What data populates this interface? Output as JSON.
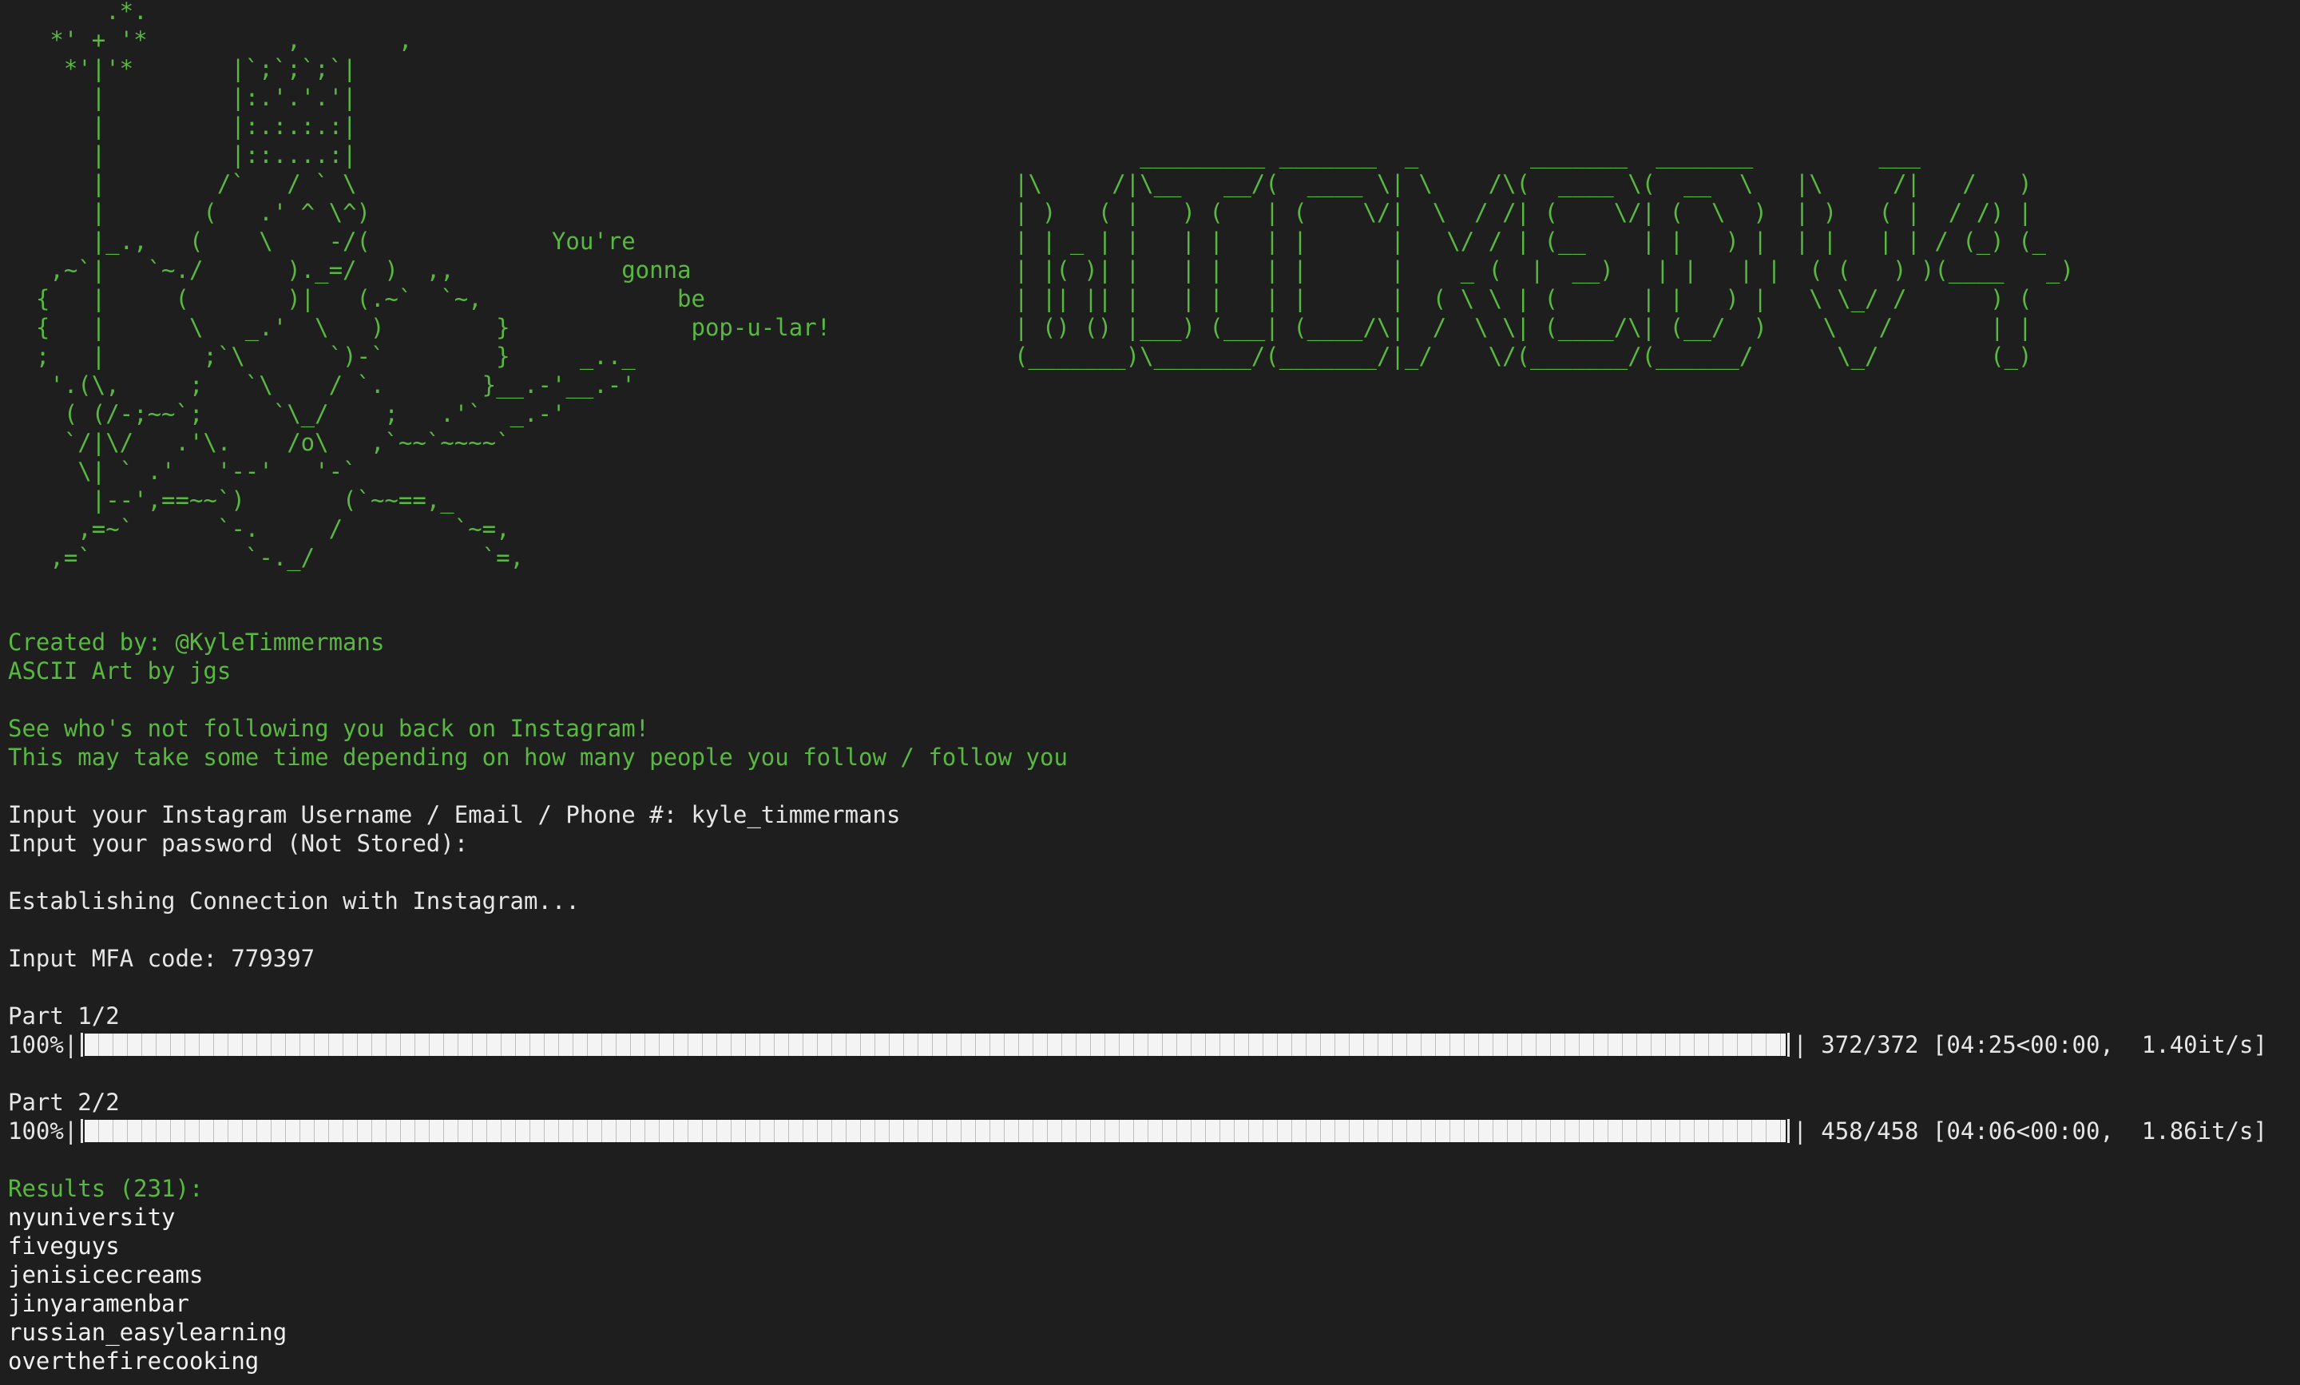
{
  "ascii_art": {
    "left": "       .*.\n   *' + '*          ,       ,\n    *'|'*       |`;`;`;`|\n      |         |:.'.'.'|\n      |         |:.:.:.:|\n      |         |::....:|\n      |        /`   / ` \\\n      |       (   .' ^ \\^)\n      |_.,   (    \\    -/(             You're\n   ,~`|   `~./      )._=/  )  ,,            gonna\n  {   |     (       )|   (.~`  `~,              be\n  {   |      \\   _.'  \\   )        }             pop-u-lar!\n  ;   |       ;`\\      `)-`        }     _.._\n   '.(\\,     ;   `\\    / `.       }__.-'__.-'\n    ( (/-;~~`;     `\\_/    ;   .'`  _.-'\n    `/|\\/   .'\\.    /o\\   ,`~~`~~~~`\n     \\| ` .'   '--'   '-`\n      |--',==~~`)       (`~~==,_\n     ,=~`      `-.     /        `~=,\n   ,=`           `-._/            `=,",
    "right": "         _________ _______  _        _______  _______         ___\n|\\     /|\\__   __/(  ____ \\| \\    /\\(  ____ \\(  __  \\   |\\     /|   /   )\n| )   ( |   ) (   | (    \\/|  \\  / /| (    \\/| (  \\  )  | )   ( |  / /) |\n| | _ | |   | |   | |      |   \\/ / | (__    | |   ) |  | |   | | / (_) (_\n| |( )| |   | |   | |      |    _ (  |  __)   | |   | |  ( (   ) )(____   _)\n| || || |   | |   | |      |  ( \\ \\ | (      | |   ) |   \\ \\_/ /      ) (\n| () () |___) (___| (____/\\|  /  \\ \\| (____/\\| (__/  )    \\   /       | |\n(_______)\\_______/(_______/|_/    \\/(_______/(______/      \\_/        (_)"
  },
  "credits": {
    "created_by": "Created by: @KyleTimmermans",
    "art_by": "ASCII Art by jgs"
  },
  "intro": {
    "line1": "See who's not following you back on Instagram!",
    "line2": "This may take some time depending on how many people you follow / follow you"
  },
  "prompts": {
    "username": "Input your Instagram Username / Email / Phone #: kyle_timmermans",
    "password": "Input your password (Not Stored):",
    "connecting": "Establishing Connection with Instagram...",
    "mfa": "Input MFA code: 779397"
  },
  "progress": [
    {
      "label": "Part 1/2",
      "percent_text": "100%|",
      "fraction": 1.0,
      "stats": "| 372/372 [04:25<00:00,  1.40it/s]"
    },
    {
      "label": "Part 2/2",
      "percent_text": "100%|",
      "fraction": 1.0,
      "stats": "| 458/458 [04:06<00:00,  1.86it/s]"
    }
  ],
  "results": {
    "header": "Results (231):",
    "items": [
      "nyuniversity",
      "fiveguys",
      "jenisicecreams",
      "jinyaramenbar",
      "russian_easylearning",
      "overthefirecooking"
    ]
  },
  "colors": {
    "background": "#1e1e1e",
    "green_text": "#59b83f",
    "white_text": "#e6e6e6"
  }
}
